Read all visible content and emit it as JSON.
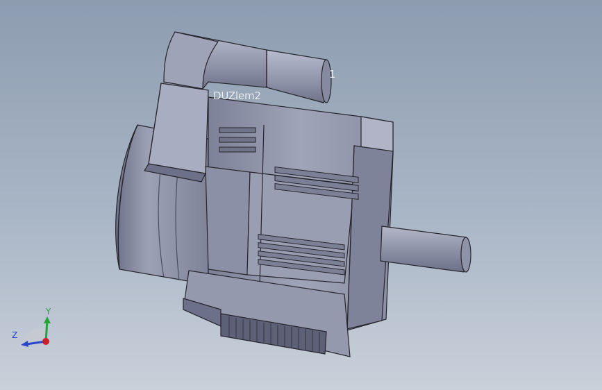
{
  "viewport": {
    "annotations": {
      "label_1": "DUZlem2",
      "label_2": "1"
    }
  },
  "triad": {
    "y_label": "Y",
    "z_label": "Z",
    "colors": {
      "y": "#27a23a",
      "z": "#2a46c9",
      "x": "#c8202a"
    }
  },
  "colors": {
    "background_top": "#8d9cb0",
    "background_bottom": "#c9d0da",
    "part_light": "#a8acbe",
    "part_mid": "#8d91a7",
    "part_dark": "#5d6178",
    "edge": "#24242c"
  }
}
